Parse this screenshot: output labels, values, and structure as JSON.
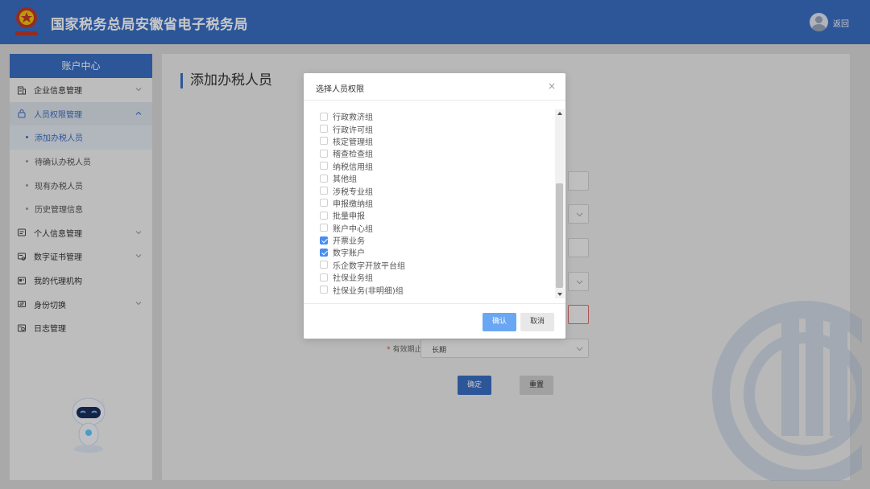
{
  "header": {
    "title": "国家税务总局安徽省电子税务局",
    "return_label": "返回",
    "logo_icon": "tax-emblem-icon"
  },
  "sidebar": {
    "heading": "账户中心",
    "items": [
      {
        "label": "企业信息管理",
        "icon": "building-icon",
        "expandable": true
      },
      {
        "label": "人员权限管理",
        "icon": "lock-icon",
        "expandable": true,
        "expanded": true
      },
      {
        "label": "个人信息管理",
        "icon": "id-card-icon",
        "expandable": true
      },
      {
        "label": "数字证书管理",
        "icon": "certificate-icon",
        "expandable": true
      },
      {
        "label": "我的代理机构",
        "icon": "agency-icon",
        "expandable": false
      },
      {
        "label": "身份切换",
        "icon": "switch-icon",
        "expandable": true
      },
      {
        "label": "日志管理",
        "icon": "log-icon",
        "expandable": false
      }
    ],
    "subitems": [
      {
        "label": "添加办税人员",
        "current": true
      },
      {
        "label": "待确认办税人员",
        "current": false
      },
      {
        "label": "现有办税人员",
        "current": false
      },
      {
        "label": "历史管理信息",
        "current": false
      }
    ]
  },
  "main": {
    "page_title": "添加办税人员",
    "validity_label": "有效期止",
    "validity_value": "长期",
    "submit_label": "确定",
    "reset_label": "重置"
  },
  "modal": {
    "title": "选择人员权限",
    "close_glyph": "×",
    "options": [
      {
        "label": "行政救济组",
        "checked": false
      },
      {
        "label": "行政许可组",
        "checked": false
      },
      {
        "label": "核定管理组",
        "checked": false
      },
      {
        "label": "稽查检查组",
        "checked": false
      },
      {
        "label": "纳税信用组",
        "checked": false
      },
      {
        "label": "其他组",
        "checked": false
      },
      {
        "label": "涉税专业组",
        "checked": false
      },
      {
        "label": "申报缴纳组",
        "checked": false
      },
      {
        "label": "批量申报",
        "checked": false
      },
      {
        "label": "账户中心组",
        "checked": false
      },
      {
        "label": "开票业务",
        "checked": true
      },
      {
        "label": "数字账户",
        "checked": true
      },
      {
        "label": "乐企数字开放平台组",
        "checked": false
      },
      {
        "label": "社保业务组",
        "checked": false
      },
      {
        "label": "社保业务(非明细)组",
        "checked": false
      }
    ],
    "confirm_label": "确认",
    "cancel_label": "取消"
  },
  "colors": {
    "primary": "#3a6fc4",
    "checkbox_checked": "#4a8df0",
    "confirm_button": "#6aa7f2"
  }
}
